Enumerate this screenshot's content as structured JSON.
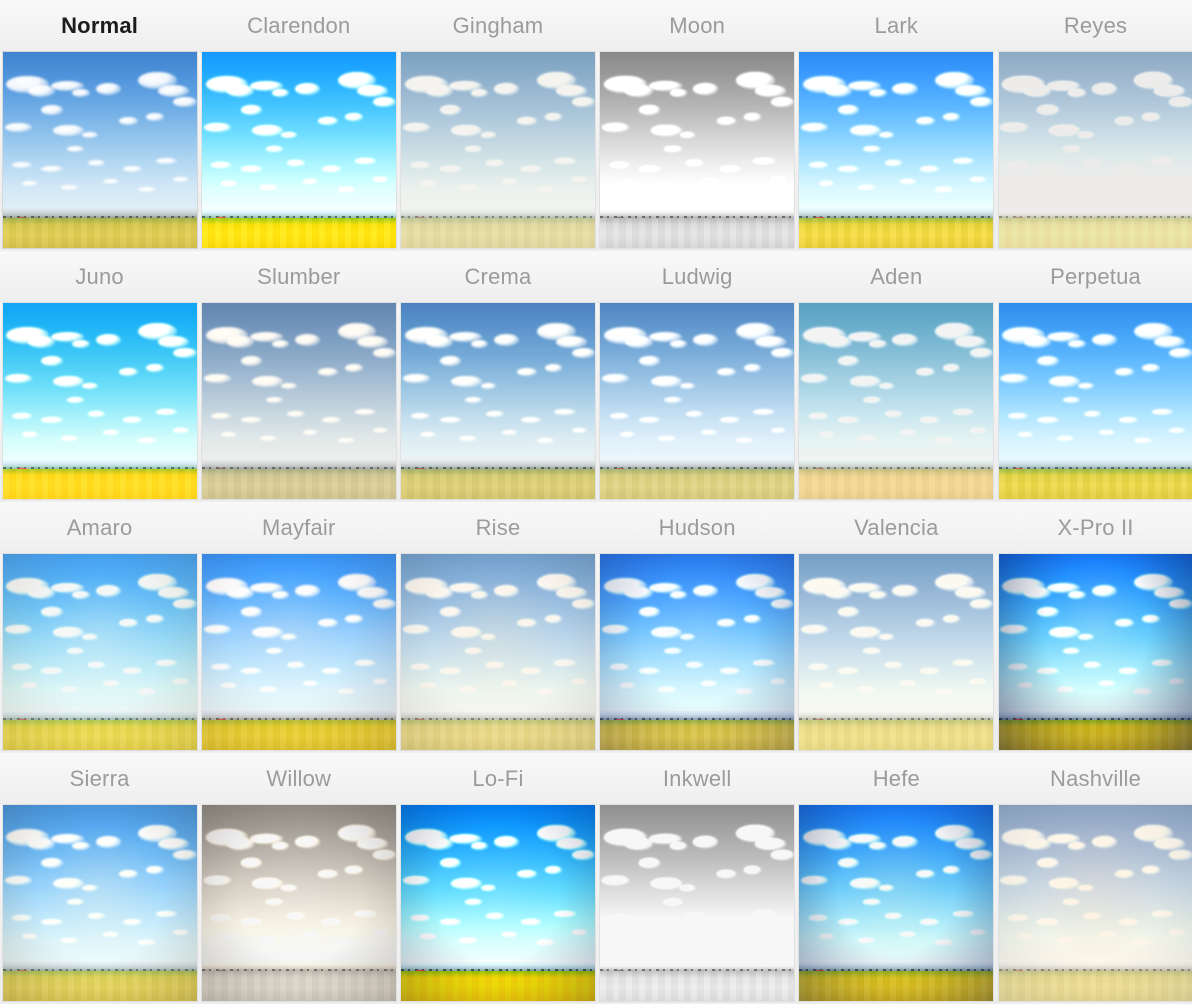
{
  "app": {
    "screen_name": "Filter Picker",
    "selected_filter": "Normal"
  },
  "grid": {
    "columns": 6,
    "rows": 4,
    "filters": [
      {
        "name": "Normal",
        "selected": true,
        "css_filter": "none",
        "vignette": "none",
        "tint": "none",
        "accent": "#4d92da"
      },
      {
        "name": "Clarendon",
        "selected": false,
        "css_filter": "saturate(1.45) contrast(1.18) brightness(1.04)",
        "vignette": "none",
        "tint": "rgba(60,190,255,0.22)",
        "accent": "#1fb6ff"
      },
      {
        "name": "Gingham",
        "selected": false,
        "css_filter": "brightness(1.1) saturate(0.62) contrast(0.86) sepia(0.08)",
        "vignette": "none",
        "tint": "rgba(200,210,205,0.30)",
        "accent": "#79b1bd"
      },
      {
        "name": "Moon",
        "selected": false,
        "css_filter": "grayscale(1) brightness(1.12) contrast(1.02)",
        "vignette": "none",
        "tint": "none",
        "accent": "#8f8f8f"
      },
      {
        "name": "Lark",
        "selected": false,
        "css_filter": "saturate(1.22) contrast(1.05) brightness(1.05)",
        "vignette": "none",
        "tint": "rgba(70,120,220,0.18)",
        "accent": "#4679d6"
      },
      {
        "name": "Reyes",
        "selected": false,
        "css_filter": "sepia(0.24) brightness(1.16) contrast(0.82) saturate(0.76)",
        "vignette": "none",
        "tint": "rgba(225,220,195,0.28)",
        "accent": "#8ebac2"
      },
      {
        "name": "Juno",
        "selected": false,
        "css_filter": "saturate(1.5) contrast(1.05) brightness(1.06) hue-rotate(-6deg)",
        "vignette": "none",
        "tint": "rgba(60,215,235,0.24)",
        "accent": "#3dc6e8"
      },
      {
        "name": "Slumber",
        "selected": false,
        "css_filter": "saturate(0.62) brightness(1.02) contrast(0.92) sepia(0.14)",
        "vignette": "none",
        "tint": "rgba(120,130,175,0.32)",
        "accent": "#7889b5"
      },
      {
        "name": "Crema",
        "selected": false,
        "css_filter": "saturate(0.82) contrast(1.02) brightness(1.0) sepia(0.08)",
        "vignette": "none",
        "tint": "rgba(90,130,185,0.18)",
        "accent": "#3b76bd"
      },
      {
        "name": "Ludwig",
        "selected": false,
        "css_filter": "saturate(0.7) contrast(1.04) brightness(1.02)",
        "vignette": "none",
        "tint": "rgba(130,150,180,0.22)",
        "accent": "#7d96b8"
      },
      {
        "name": "Aden",
        "selected": false,
        "css_filter": "saturate(0.72) brightness(1.1) contrast(0.9) hue-rotate(-12deg)",
        "vignette": "none",
        "tint": "rgba(180,200,190,0.26)",
        "accent": "#83b2b4"
      },
      {
        "name": "Perpetua",
        "selected": false,
        "css_filter": "saturate(1.18) contrast(1.02) brightness(1.04)",
        "vignette": "none",
        "tint": "rgba(70,150,225,0.20)",
        "accent": "#4a95de"
      },
      {
        "name": "Amaro",
        "selected": false,
        "css_filter": "saturate(1.25) brightness(1.1) contrast(0.92)",
        "vignette": "radial-gradient(ellipse at 50% 45%, rgba(255,255,255,0.28) 0%, rgba(255,255,255,0.06) 45%, rgba(120,100,60,0.18) 100%)",
        "tint": "rgba(120,190,215,0.22)",
        "accent": "#4b8fd1"
      },
      {
        "name": "Mayfair",
        "selected": false,
        "css_filter": "saturate(1.32) contrast(1.08) brightness(1.02)",
        "vignette": "radial-gradient(ellipse at 45% 40%, rgba(255,240,235,0.22) 0%, rgba(255,220,215,0.05) 40%, rgba(90,60,70,0.22) 100%)",
        "tint": "rgba(240,180,190,0.18)",
        "accent": "#2f6fd0"
      },
      {
        "name": "Rise",
        "selected": false,
        "css_filter": "saturate(0.88) brightness(1.1) contrast(0.9) sepia(0.1)",
        "vignette": "radial-gradient(ellipse at 50% 45%, rgba(255,235,205,0.30) 0%, rgba(255,235,205,0.08) 48%, rgba(110,95,75,0.18) 100%)",
        "tint": "rgba(210,200,215,0.20)",
        "accent": "#6f8fc4"
      },
      {
        "name": "Hudson",
        "selected": false,
        "css_filter": "saturate(1.15) contrast(1.18) brightness(1.0)",
        "vignette": "radial-gradient(ellipse at 50% 42%, rgba(220,235,255,0.18) 0%, rgba(160,190,240,0.05) 42%, rgba(30,35,90,0.32) 100%)",
        "tint": "rgba(60,80,230,0.26)",
        "accent": "#2f36c4"
      },
      {
        "name": "Valencia",
        "selected": false,
        "css_filter": "saturate(0.8) brightness(1.1) contrast(0.9) sepia(0.12)",
        "vignette": "none",
        "tint": "rgba(225,205,175,0.26)",
        "accent": "#82a9dc"
      },
      {
        "name": "X-Pro II",
        "selected": false,
        "css_filter": "saturate(1.42) contrast(1.22) brightness(1.0)",
        "vignette": "radial-gradient(ellipse at 50% 38%, rgba(255,255,235,0.20) 0%, rgba(200,220,230,0.04) 38%, rgba(12,20,70,0.55) 100%)",
        "tint": "rgba(30,60,190,0.24)",
        "accent": "#0d2a7a"
      },
      {
        "name": "Sierra",
        "selected": false,
        "css_filter": "saturate(1.1) contrast(1.0) brightness(1.06)",
        "vignette": "radial-gradient(ellipse at 50% 45%, rgba(255,250,225,0.30) 0%, rgba(240,235,210,0.08) 45%, rgba(90,80,60,0.26) 100%)",
        "tint": "rgba(120,175,220,0.20)",
        "accent": "#2f6fcf"
      },
      {
        "name": "Willow",
        "selected": false,
        "css_filter": "grayscale(1) sepia(0.22) brightness(1.1) contrast(0.94)",
        "vignette": "radial-gradient(ellipse at 50% 45%, rgba(255,255,255,0.18) 0%, rgba(230,225,220,0.04) 45%, rgba(80,70,65,0.28) 100%)",
        "tint": "none",
        "accent": "#8b8480"
      },
      {
        "name": "Lo-Fi",
        "selected": false,
        "css_filter": "saturate(1.6) contrast(1.3) brightness(1.0)",
        "vignette": "radial-gradient(ellipse at 50% 45%, rgba(255,255,255,0.10) 0%, rgba(200,210,230,0.02) 45%, rgba(20,25,60,0.30) 100%)",
        "tint": "rgba(20,90,240,0.22)",
        "accent": "#1452e8"
      },
      {
        "name": "Inkwell",
        "selected": false,
        "css_filter": "grayscale(1) brightness(1.2) contrast(0.94)",
        "vignette": "none",
        "tint": "none",
        "accent": "#a8a8a8"
      },
      {
        "name": "Hefe",
        "selected": false,
        "css_filter": "saturate(1.38) contrast(1.22) brightness(0.98)",
        "vignette": "radial-gradient(ellipse at 50% 42%, rgba(255,250,220,0.16) 0%, rgba(200,210,230,0.03) 42%, rgba(20,30,80,0.42) 100%)",
        "tint": "rgba(40,70,200,0.22)",
        "accent": "#2d52b8"
      },
      {
        "name": "Nashville",
        "selected": false,
        "css_filter": "saturate(0.82) brightness(1.12) contrast(0.86) sepia(0.2)",
        "vignette": "radial-gradient(ellipse at 50% 45%, rgba(255,225,200,0.28) 0%, rgba(250,220,200,0.08) 45%, rgba(120,140,150,0.20) 100%)",
        "tint": "rgba(240,195,175,0.26)",
        "accent": "#45a0bd"
      }
    ],
    "clouds": [
      {
        "l": 2,
        "t": 12,
        "w": 22,
        "h": 9
      },
      {
        "l": 13,
        "t": 17,
        "w": 14,
        "h": 6
      },
      {
        "l": 20,
        "t": 27,
        "w": 11,
        "h": 5
      },
      {
        "l": 25,
        "t": 15,
        "w": 17,
        "h": 5
      },
      {
        "l": 36,
        "t": 19,
        "w": 9,
        "h": 4
      },
      {
        "l": 48,
        "t": 16,
        "w": 13,
        "h": 6
      },
      {
        "l": 70,
        "t": 10,
        "w": 20,
        "h": 9
      },
      {
        "l": 80,
        "t": 17,
        "w": 16,
        "h": 6
      },
      {
        "l": 88,
        "t": 23,
        "w": 12,
        "h": 5
      },
      {
        "l": 1,
        "t": 36,
        "w": 14,
        "h": 5
      },
      {
        "l": 26,
        "t": 37,
        "w": 16,
        "h": 6
      },
      {
        "l": 41,
        "t": 41,
        "w": 8,
        "h": 3
      },
      {
        "l": 60,
        "t": 33,
        "w": 10,
        "h": 4
      },
      {
        "l": 74,
        "t": 31,
        "w": 9,
        "h": 4
      },
      {
        "l": 33,
        "t": 48,
        "w": 9,
        "h": 3
      },
      {
        "l": 5,
        "t": 56,
        "w": 10,
        "h": 3
      },
      {
        "l": 20,
        "t": 58,
        "w": 11,
        "h": 3
      },
      {
        "l": 44,
        "t": 55,
        "w": 9,
        "h": 3
      },
      {
        "l": 62,
        "t": 58,
        "w": 10,
        "h": 3
      },
      {
        "l": 79,
        "t": 54,
        "w": 11,
        "h": 3
      },
      {
        "l": 10,
        "t": 66,
        "w": 8,
        "h": 2.5
      },
      {
        "l": 30,
        "t": 68,
        "w": 9,
        "h": 2.5
      },
      {
        "l": 52,
        "t": 65,
        "w": 8,
        "h": 2.5
      },
      {
        "l": 70,
        "t": 69,
        "w": 9,
        "h": 2.5
      },
      {
        "l": 88,
        "t": 64,
        "w": 8,
        "h": 2.5
      }
    ]
  }
}
